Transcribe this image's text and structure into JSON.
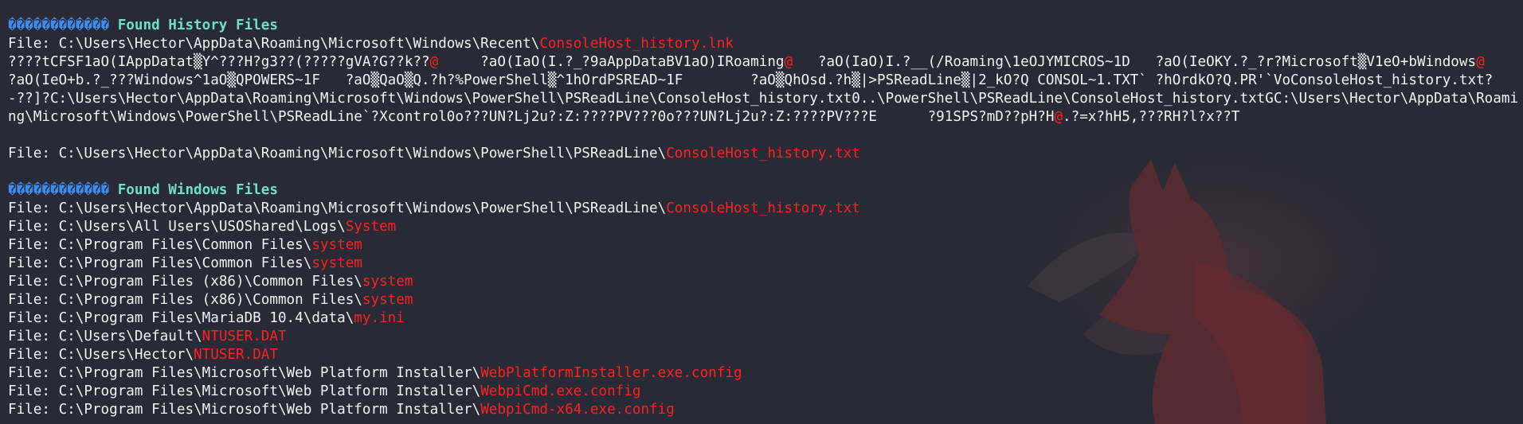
{
  "theme": {
    "background": "#282a36",
    "text": "#f2f2f2",
    "highlight": "#ff2020",
    "header": "#6ee0c4",
    "marker": "#3d8cf0"
  },
  "section_history": {
    "marker": "������������",
    "title": "Found History Files",
    "file_prefix": "File: ",
    "lnk_path": "C:\\Users\\Hector\\AppData\\Roaming\\Microsoft\\Windows\\Recent\\",
    "lnk_name": "ConsoleHost_history.lnk",
    "binary_part1": "????tCFSF1aO(IAppDatat▒Y^???H?g3??(?????gVA?G??k??",
    "binary_at1": "@",
    "binary_part2": "     ?aO(IaO(I.?_?9aAppDataBV1aO)IRoaming",
    "binary_at2": "@",
    "binary_part3": "   ?aO(IaO)I.?__(/Roaming\\1eOJYMICROS~1D   ?aO(IeOKY.?_?r?Microsoft▒V1eO+bWindows",
    "binary_at3": "@",
    "binary_part4": "     ?aO(IeO+b.?_???Windows^1aO▒QPOWERS~1F   ?aO▒QaO▒Q.?h?%PowerShell▒^1hOrdPSREAD~1F        ?aO▒QhOsd.?h▒|>PSReadLine▒|2_kO?Q CONSOL~1.TXT` ?hOrdkO?Q.PR'`VoConsoleHost_history.txt?-??]?C:\\Users\\Hector\\AppData\\Roaming\\Microsoft\\Windows\\PowerShell\\PSReadLine\\ConsoleHost_history.txt0..\\PowerShell\\PSReadLine\\ConsoleHost_history.txtGC:\\Users\\Hector\\AppData\\Roaming\\Microsoft\\Windows\\PowerShell\\PSReadLine`?Xcontrol0o???UN?Lj2u?:Z:????PV???0o???UN?Lj2u?:Z:????PV???E      ?91SPS?mD??pH?H",
    "binary_at4": "@",
    "binary_part5": ".?=x?hH5,???RH?l?x??T",
    "txt_path": "C:\\Users\\Hector\\AppData\\Roaming\\Microsoft\\Windows\\PowerShell\\PSReadLine\\",
    "txt_name": "ConsoleHost_history.txt"
  },
  "section_windows": {
    "marker": "������������",
    "title": "Found Windows Files",
    "file_prefix": "File: ",
    "files": [
      {
        "path": "C:\\Users\\Hector\\AppData\\Roaming\\Microsoft\\Windows\\PowerShell\\PSReadLine\\",
        "name": "ConsoleHost_history.txt"
      },
      {
        "path": "C:\\Users\\All Users\\USOShared\\Logs\\",
        "name": "System"
      },
      {
        "path": "C:\\Program Files\\Common Files\\",
        "name": "system"
      },
      {
        "path": "C:\\Program Files\\Common Files\\",
        "name": "system"
      },
      {
        "path": "C:\\Program Files (x86)\\Common Files\\",
        "name": "system"
      },
      {
        "path": "C:\\Program Files (x86)\\Common Files\\",
        "name": "system"
      },
      {
        "path": "C:\\Program Files\\MariaDB 10.4\\data\\",
        "name": "my.ini"
      },
      {
        "path": "C:\\Users\\Default\\",
        "name": "NTUSER.DAT"
      },
      {
        "path": "C:\\Users\\Hector\\",
        "name": "NTUSER.DAT"
      },
      {
        "path": "C:\\Program Files\\Microsoft\\Web Platform Installer\\",
        "name": "WebPlatformInstaller.exe.config"
      },
      {
        "path": "C:\\Program Files\\Microsoft\\Web Platform Installer\\",
        "name": "WebpiCmd.exe.config"
      },
      {
        "path": "C:\\Program Files\\Microsoft\\Web Platform Installer\\",
        "name": "WebpiCmd-x64.exe.config"
      }
    ]
  }
}
